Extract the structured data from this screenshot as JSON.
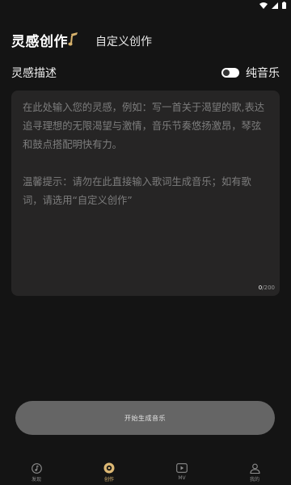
{
  "tabs": {
    "active": "灵感创作",
    "inactive": "自定义创作"
  },
  "section": {
    "title": "灵感描述",
    "pure_music_label": "纯音乐",
    "pure_music_enabled": false
  },
  "input": {
    "placeholder": "在此处输入您的灵感，例如：写一首关于渴望的歌,表达追寻理想的无限渴望与激情，音乐节奏悠扬激昂，琴弦和鼓点搭配明快有力。\n\n温馨提示：请勿在此直接输入歌词生成音乐；如有歌词，请选用“自定义创作”",
    "count_current": "0",
    "count_max": "/200"
  },
  "generate_button": "开始生成音乐",
  "nav": [
    {
      "label": "发现",
      "icon": "music-note-icon"
    },
    {
      "label": "创作",
      "icon": "disc-icon"
    },
    {
      "label": "MV",
      "icon": "video-play-icon"
    },
    {
      "label": "我的",
      "icon": "person-icon"
    }
  ],
  "colors": {
    "background": "#141414",
    "panel": "#262525",
    "accent": "#ddb874",
    "button": "#656565"
  }
}
